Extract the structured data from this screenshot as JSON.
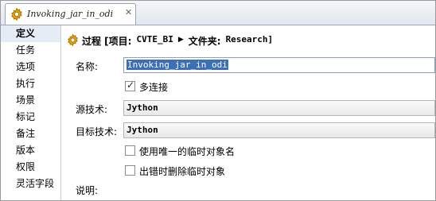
{
  "editor_tab": {
    "title": "Invoking_jar_in_odi",
    "close_glyph": "✕",
    "icon": "gear-icon"
  },
  "sidebar": {
    "items": [
      {
        "label": "定义",
        "active": true
      },
      {
        "label": "任务"
      },
      {
        "label": "选项"
      },
      {
        "label": "执行"
      },
      {
        "label": "场景"
      },
      {
        "label": "标记"
      },
      {
        "label": "备注"
      },
      {
        "label": "版本"
      },
      {
        "label": "权限"
      },
      {
        "label": "灵活字段"
      }
    ]
  },
  "header": {
    "prefix": "过程 [项目:",
    "project": "CVTE_BI",
    "arrow": "▶",
    "folder_prefix": "文件夹:",
    "folder": "Research]",
    "icon": "gear-icon"
  },
  "form": {
    "name_label": "名称:",
    "name_value": "Invoking_jar_in_odi",
    "multi_conn_label": "多连接",
    "multi_conn_checked": true,
    "source_tech_label": "源技术:",
    "source_tech_value": "Jython",
    "target_tech_label": "目标技术:",
    "target_tech_value": "Jython",
    "unique_temp_label": "使用唯一的临时对象名",
    "unique_temp_checked": false,
    "delete_temp_label": "出错时删除临时对象",
    "delete_temp_checked": false,
    "description_label": "说明:"
  },
  "colors": {
    "selection": "#3c6fb5",
    "nav_active_bg": "#e6ecf5",
    "gear": "#e0a000"
  }
}
